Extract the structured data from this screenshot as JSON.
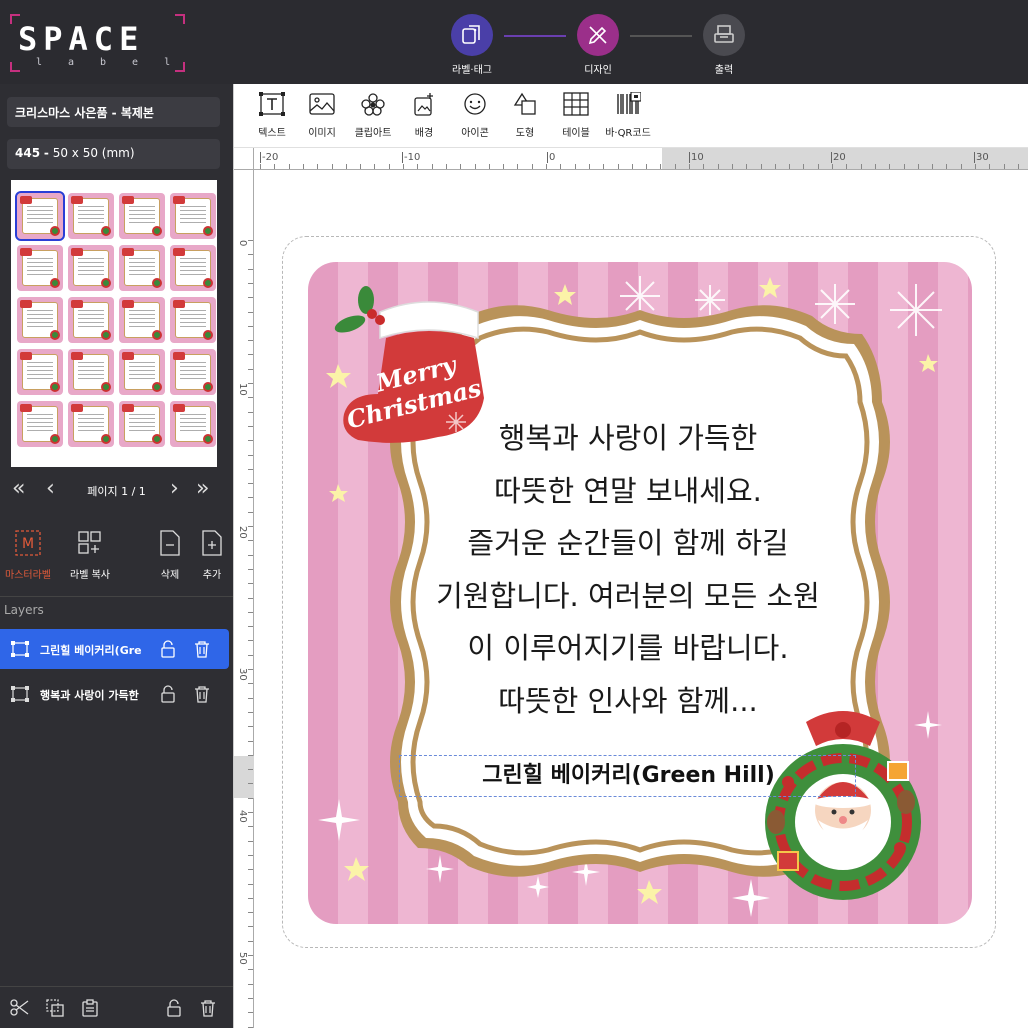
{
  "app": {
    "logo_main": "SPACE",
    "logo_sub": "label"
  },
  "steps": [
    {
      "label": "라벨·태그",
      "active": true,
      "color": "#4a3fa8"
    },
    {
      "label": "디자인",
      "active": true,
      "color": "#9b2f8a"
    },
    {
      "label": "출력",
      "active": false,
      "color": "#4a4a50"
    }
  ],
  "document": {
    "title": "크리스마스 사은품 - 복제본",
    "size_code": "445",
    "size_dash": "-",
    "size_text": "50 x 50 (mm)"
  },
  "pager": {
    "label": "페이지 1 / 1"
  },
  "actions": {
    "master_label": "마스터라벨",
    "copy_label": "라벨 복사",
    "delete": "삭제",
    "add": "추가"
  },
  "layers": {
    "heading": "Layers",
    "items": [
      {
        "name": "그린힐 베이커리(Gre",
        "active": true
      },
      {
        "name": "행복과 사랑이 가득한",
        "active": false
      }
    ]
  },
  "toolbar": {
    "text": "텍스트",
    "image": "이미지",
    "clipart": "클립아트",
    "background": "배경",
    "icon": "아이콘",
    "shape": "도형",
    "table": "테이블",
    "barcode": "바·QR코드"
  },
  "ruler": {
    "h_ticks": [
      "-20",
      "-10",
      "0",
      "10",
      "20",
      "30"
    ],
    "v_ticks": [
      "0",
      "10",
      "20",
      "30",
      "40",
      "50"
    ]
  },
  "label": {
    "stocking_line1": "Merry",
    "stocking_line2": "Christmas",
    "message": [
      "행복과 사랑이 가득한",
      "따뜻한 연말 보내세요.",
      "즐거운 순간들이 함께 하길",
      "기원합니다. 여러분의 모든 소원",
      "이 이루어지기를 바랍니다.",
      "따뜻한 인사와 함께..."
    ],
    "signature": "그린힐 베이커리(Green Hill)"
  },
  "colors": {
    "topbar": "#2b2b30",
    "panel": "#2e2e33",
    "active_layer": "#2f66e8",
    "label_pink": "#e49dc1",
    "frame_gold": "#b9935a"
  }
}
